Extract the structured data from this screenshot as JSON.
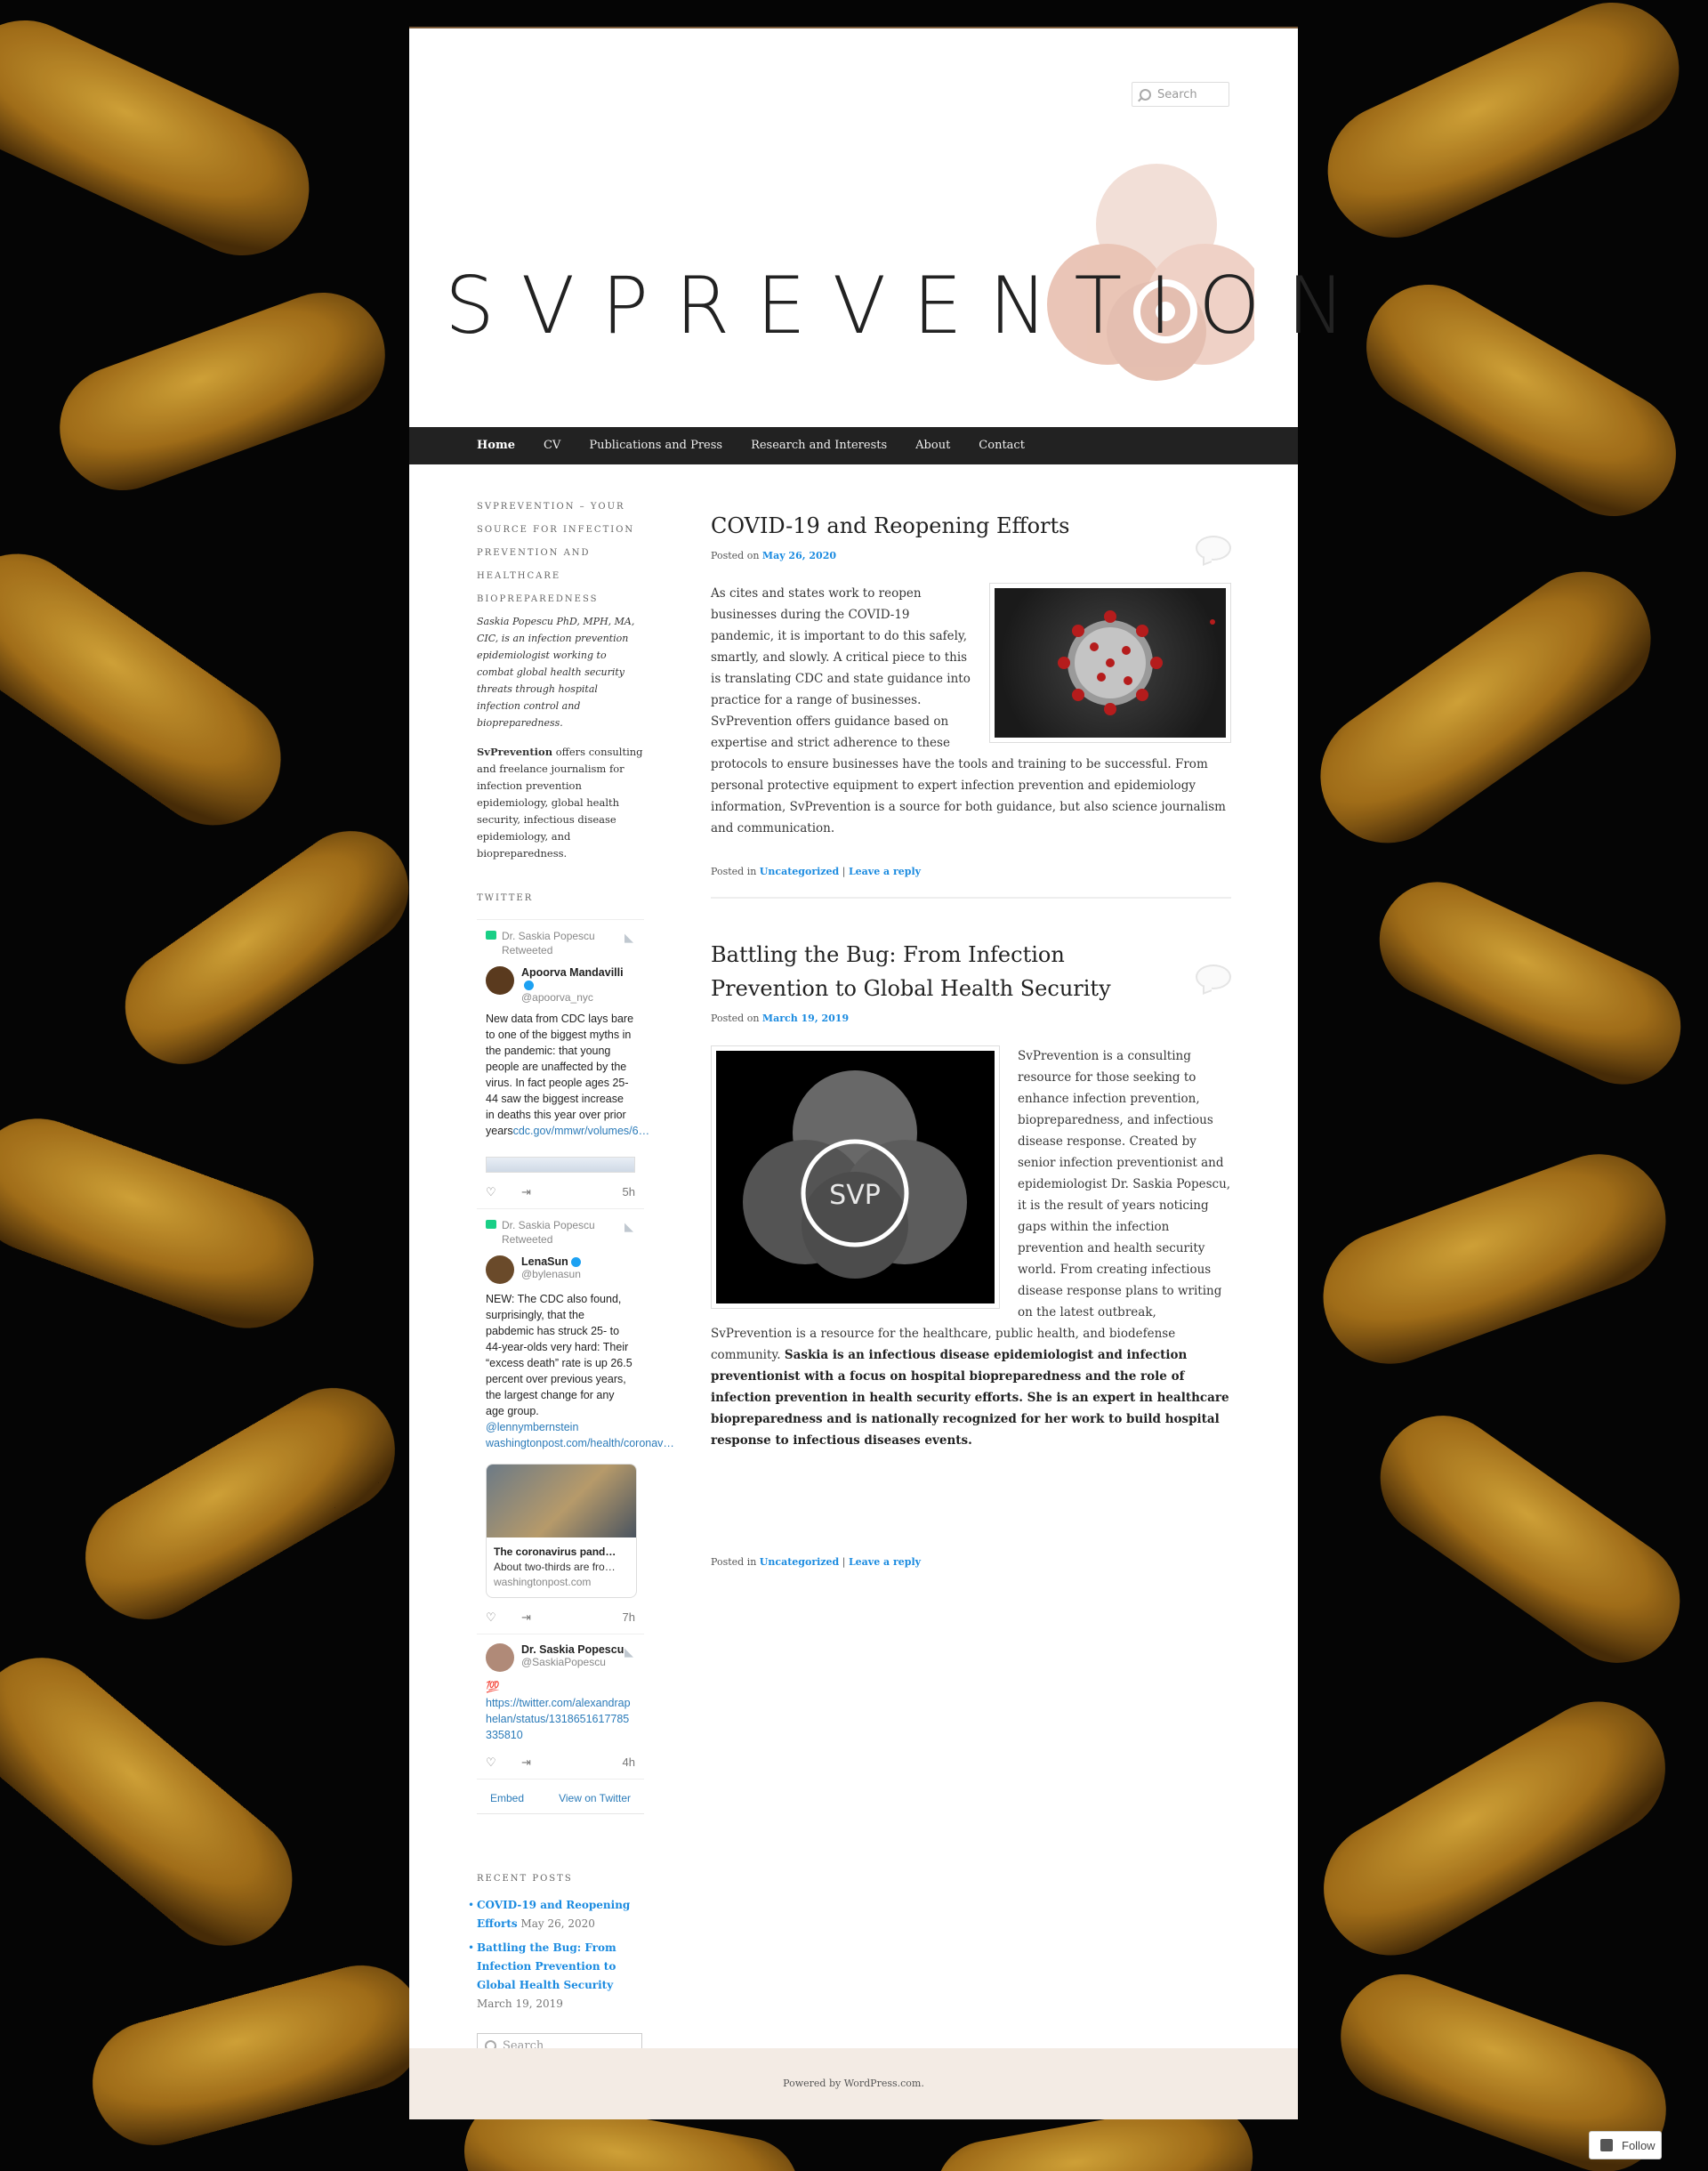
{
  "header": {
    "search_placeholder": "Search",
    "logo_text": "SVPREVENTION"
  },
  "nav": {
    "items": [
      "Home",
      "CV",
      "Publications and Press",
      "Research and Interests",
      "About",
      "Contact"
    ],
    "active": "Home"
  },
  "sidebar": {
    "about_title": "SVPREVENTION – YOUR SOURCE FOR INFECTION PREVENTION AND HEALTHCARE BIOPREPAREDNESS",
    "about_italic": "Saskia Popescu PhD, MPH, MA, CIC, is an infection prevention epidemiologist working to combat global health security threats through hospital infection control and biopreparedness.",
    "about_bold": "SvPrevention",
    "about_body": " offers consulting and freelance journalism for infection prevention epidemiology, global health security, infectious disease epidemiology, and biopreparedness.",
    "twitter_title": "TWITTER",
    "tweets": [
      {
        "retweeted_by": "Dr. Saskia Popescu Retweeted",
        "name": "Apoorva Mandavilli",
        "handle": "@apoorva_nyc",
        "text": "New data from CDC lays bare to one of the biggest myths in the pandemic: that young people are unaffected by the virus. In fact people ages 25-44 saw the biggest increase in deaths this year over prior years",
        "link": "cdc.gov/mmwr/volumes/6…",
        "time": "5h"
      },
      {
        "retweeted_by": "Dr. Saskia Popescu Retweeted",
        "name": "LenaSun",
        "handle": "@bylenasun",
        "text": "NEW: The CDC also found, surprisingly, that the pabdemic has struck 25- to 44-year-olds very hard: Their “excess death” rate is up 26.5 percent over previous years, the largest change for any age group.",
        "mention": "@lennymbernstein",
        "link": "washingtonpost.com/health/coronav…",
        "card_title": "The coronavirus pand…",
        "card_desc": "About two-thirds are fro…",
        "card_domain": "washingtonpost.com",
        "time": "7h"
      },
      {
        "name": "Dr. Saskia Popescu",
        "handle": "@SaskiaPopescu",
        "emoji": "💯",
        "link": "https://twitter.com/alexandraphelan/status/1318651617785335810",
        "time": "4h"
      }
    ],
    "embed_label": "Embed",
    "view_label": "View on Twitter",
    "recent_title": "RECENT POSTS",
    "recent_posts": [
      {
        "title": "COVID-19 and Reopening Efforts",
        "date": "May 26, 2020"
      },
      {
        "title": "Battling the Bug: From Infection Prevention to Global Health Security",
        "date": "March 19, 2019"
      }
    ],
    "search_placeholder": "Search"
  },
  "posts": [
    {
      "title": "COVID-19 and Reopening Efforts",
      "posted_on": "Posted on",
      "date": "May 26, 2020",
      "body": "As cites and states work to reopen businesses during the COVID-19 pandemic, it is important to do this safely, smartly, and slowly. A critical piece to this is translating CDC and state guidance into practice for a range of businesses. SvPrevention offers guidance based on expertise and strict adherence to these protocols to ensure businesses have the tools and training to be successful. From personal protective equipment to expert infection prevention and epidemiology information, SvPrevention is a source for both guidance, but also science journalism and communication.",
      "posted_in": "Posted in",
      "category": "Uncategorized",
      "reply": "Leave a reply"
    },
    {
      "title": "Battling the Bug: From Infection Prevention to Global Health Security",
      "posted_on": "Posted on",
      "date": "March 19, 2019",
      "body": "SvPrevention is a consulting resource for those seeking to enhance infection prevention, biopreparedness, and infectious disease response. Created by senior infection preventionist and epidemiologist Dr. Saskia Popescu, it is the result of years noticing gaps within the infection prevention and health security world. From creating infectious disease response plans to writing on the latest outbreak, SvPrevention is a resource for the healthcare, public health, and biodefense community. ",
      "body_bold": "Saskia is an infectious disease epidemiologist and infection preventionist with a focus on hospital biopreparedness and the role of infection prevention in health security efforts. She is an expert in healthcare biopreparedness and is nationally recognized for her work to build hospital response to infectious diseases events.",
      "image_label": "SVP",
      "posted_in": "Posted in",
      "category": "Uncategorized",
      "reply": "Leave a reply"
    }
  ],
  "footer": {
    "text": "Powered by WordPress.com."
  },
  "follow": {
    "label": "Follow"
  }
}
